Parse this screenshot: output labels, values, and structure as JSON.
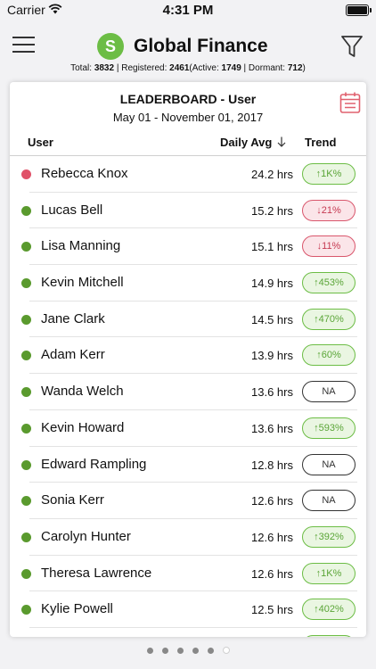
{
  "status_bar": {
    "carrier": "Carrier",
    "time": "4:31 PM"
  },
  "header": {
    "logo_letter": "S",
    "title": "Global Finance",
    "summary": {
      "total_label": "Total: ",
      "total": "3832",
      "sep1": " | ",
      "registered_label": "Registered: ",
      "registered": "2461",
      "active_label": "(Active: ",
      "active": "1749",
      "sep2": " | ",
      "dormant_label": "Dormant: ",
      "dormant": "712",
      "close": ")"
    }
  },
  "card": {
    "title": "LEADERBOARD - User",
    "date_range": "May 01 - November 01, 2017",
    "columns": {
      "user": "User",
      "avg": "Daily Avg",
      "trend": "Trend"
    },
    "rows": [
      {
        "name": "Rebecca Knox",
        "avg": "24.2 hrs",
        "trend": "↑1K%",
        "direction": "up",
        "status": "red"
      },
      {
        "name": "Lucas Bell",
        "avg": "15.2 hrs",
        "trend": "↓21%",
        "direction": "down",
        "status": "green"
      },
      {
        "name": "Lisa Manning",
        "avg": "15.1 hrs",
        "trend": "↓11%",
        "direction": "down",
        "status": "green"
      },
      {
        "name": "Kevin Mitchell",
        "avg": "14.9 hrs",
        "trend": "↑453%",
        "direction": "up",
        "status": "green"
      },
      {
        "name": "Jane Clark",
        "avg": "14.5 hrs",
        "trend": "↑470%",
        "direction": "up",
        "status": "green"
      },
      {
        "name": "Adam Kerr",
        "avg": "13.9 hrs",
        "trend": "↑60%",
        "direction": "up",
        "status": "green"
      },
      {
        "name": "Wanda Welch",
        "avg": "13.6 hrs",
        "trend": "NA",
        "direction": "na",
        "status": "green"
      },
      {
        "name": "Kevin Howard",
        "avg": "13.6 hrs",
        "trend": "↑593%",
        "direction": "up",
        "status": "green"
      },
      {
        "name": "Edward Rampling",
        "avg": "12.8 hrs",
        "trend": "NA",
        "direction": "na",
        "status": "green"
      },
      {
        "name": "Sonia Kerr",
        "avg": "12.6 hrs",
        "trend": "NA",
        "direction": "na",
        "status": "green"
      },
      {
        "name": "Carolyn Hunter",
        "avg": "12.6 hrs",
        "trend": "↑392%",
        "direction": "up",
        "status": "green"
      },
      {
        "name": "Theresa Lawrence",
        "avg": "12.6 hrs",
        "trend": "↑1K%",
        "direction": "up",
        "status": "green"
      },
      {
        "name": "Kylie Powell",
        "avg": "12.5 hrs",
        "trend": "↑402%",
        "direction": "up",
        "status": "green"
      },
      {
        "name": "",
        "avg": "",
        "trend": "",
        "direction": "up",
        "status": "green"
      }
    ]
  },
  "pagination": {
    "count": 6,
    "active_index": 5
  },
  "colors": {
    "green": "#5a9a2e",
    "red": "#e05269",
    "brand": "#6cbd45"
  }
}
